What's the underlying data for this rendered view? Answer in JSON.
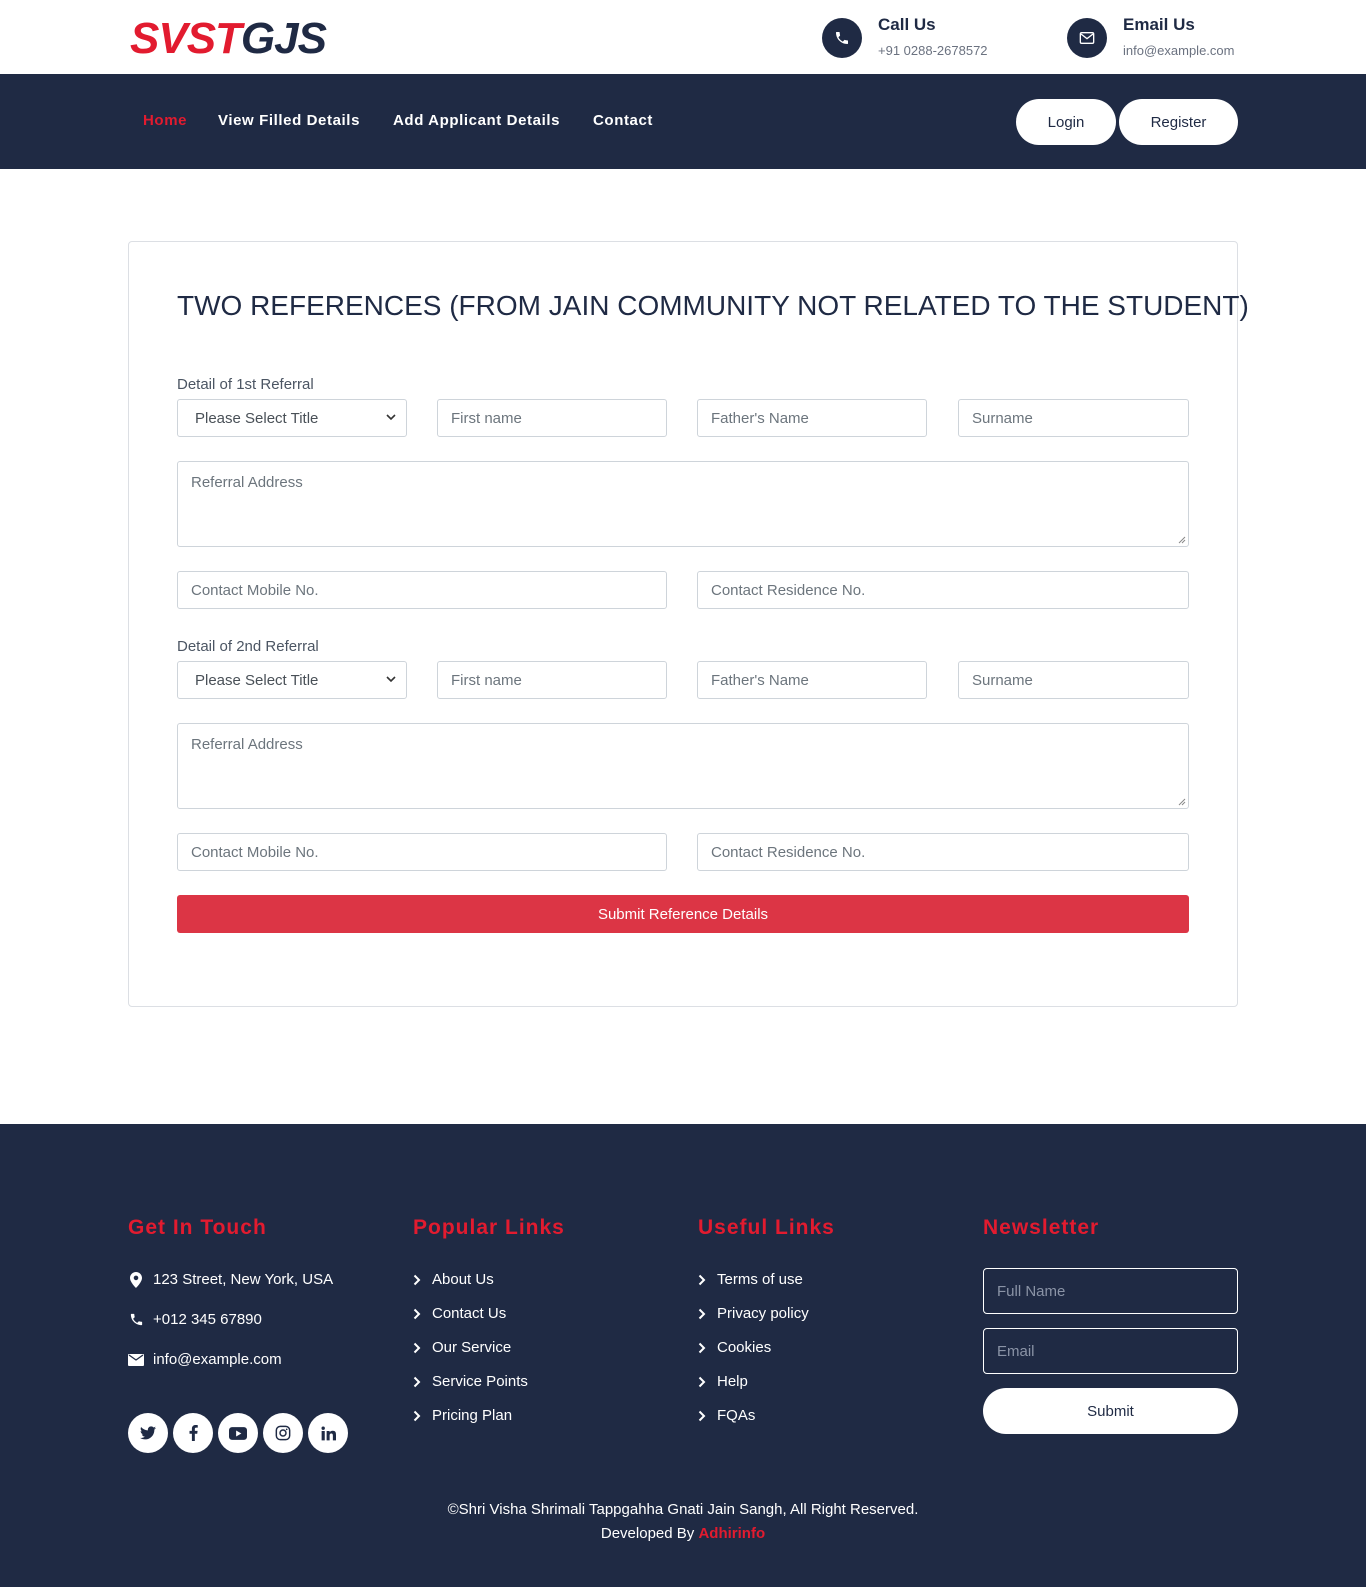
{
  "header": {
    "logo_part1": "SVST",
    "logo_part2": "GJS",
    "call": {
      "title": "Call Us",
      "value": "+91 0288-2678572",
      "icon": "phone-icon"
    },
    "email": {
      "title": "Email Us",
      "value": "info@example.com",
      "icon": "envelope-icon"
    }
  },
  "nav": {
    "items": [
      "Home",
      "View Filled Details",
      "Add Applicant Details",
      "Contact"
    ],
    "active_index": 0,
    "login_label": "Login",
    "register_label": "Register"
  },
  "form": {
    "title": "TWO REFERENCES (FROM JAIN COMMUNITY NOT RELATED TO THE STUDENT)",
    "referrals": [
      {
        "section_label": "Detail of 1st Referral",
        "title_select": "Please Select Title",
        "first_name_placeholder": "First name",
        "father_name_placeholder": "Father's Name",
        "surname_placeholder": "Surname",
        "address_placeholder": "Referral Address",
        "mobile_placeholder": "Contact Mobile No.",
        "residence_placeholder": "Contact Residence No."
      },
      {
        "section_label": "Detail of 2nd Referral",
        "title_select": "Please Select Title",
        "first_name_placeholder": "First name",
        "father_name_placeholder": "Father's Name",
        "surname_placeholder": "Surname",
        "address_placeholder": "Referral Address",
        "mobile_placeholder": "Contact Mobile No.",
        "residence_placeholder": "Contact Residence No."
      }
    ],
    "submit_label": "Submit Reference Details"
  },
  "footer": {
    "get_in_touch": {
      "heading": "Get In Touch",
      "address": "123 Street, New York, USA",
      "phone": "+012 345 67890",
      "email": "info@example.com"
    },
    "social_icons": [
      "twitter-icon",
      "facebook-icon",
      "youtube-icon",
      "instagram-icon",
      "linkedin-icon"
    ],
    "popular_links": {
      "heading": "Popular Links",
      "items": [
        "About Us",
        "Contact Us",
        "Our Service",
        "Service Points",
        "Pricing Plan"
      ]
    },
    "useful_links": {
      "heading": "Useful Links",
      "items": [
        "Terms of use",
        "Privacy policy",
        "Cookies",
        "Help",
        "FQAs"
      ]
    },
    "newsletter": {
      "heading": "Newsletter",
      "name_placeholder": "Full Name",
      "email_placeholder": "Email",
      "submit_label": "Submit"
    },
    "copyright": "©Shri Visha Shrimali Tappgahha Gnati Jain Sangh, All Right Reserved.",
    "developed_by": "Developed By",
    "developer": "Adhirinfo"
  },
  "colors": {
    "navy": "#1f2a44",
    "accent_red": "#e21b2f",
    "button_red": "#dc3545"
  }
}
